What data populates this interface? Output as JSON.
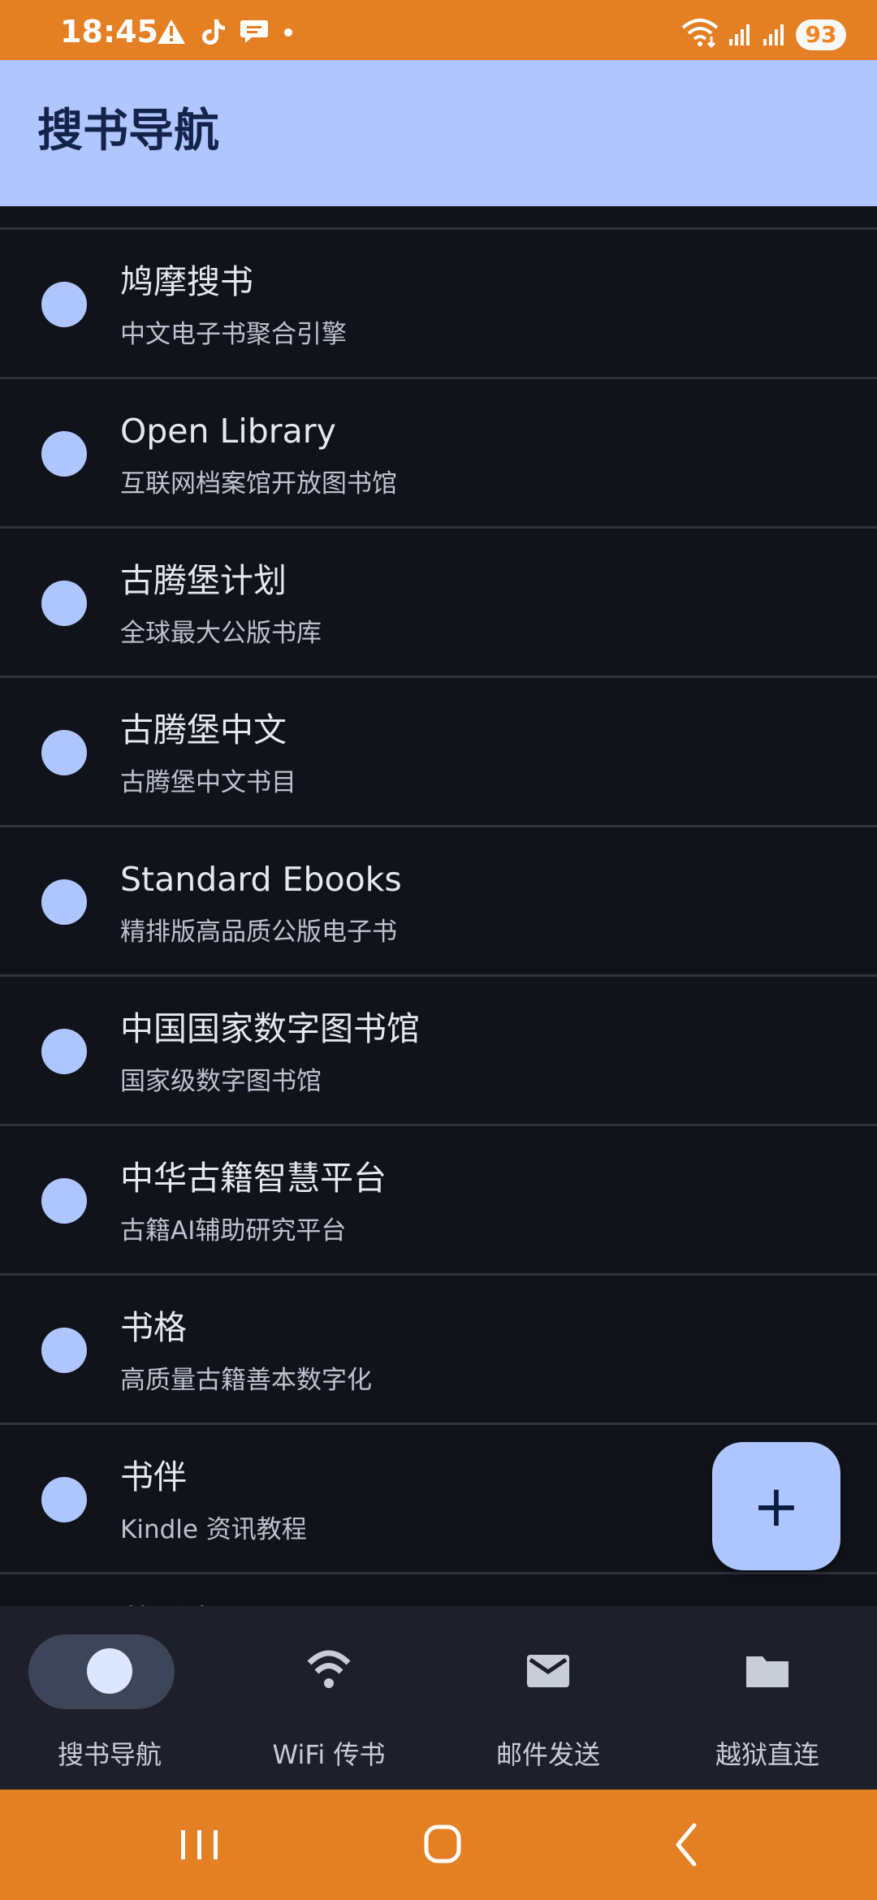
{
  "status_bar": {
    "time": "18:45",
    "battery": "93",
    "left_icons": [
      "warning-icon",
      "tiktok-icon",
      "message-icon",
      "dot-icon"
    ],
    "right_icons": [
      "wifi-status-icon",
      "signal-icon-1",
      "signal-icon-2"
    ],
    "background": "#e57f24"
  },
  "app_bar": {
    "title": "搜书导航",
    "background": "#afc6ff"
  },
  "list": {
    "items": [
      {
        "title": "鸠摩搜书",
        "subtitle": "中文电子书聚合引擎"
      },
      {
        "title": "Open Library",
        "subtitle": "互联网档案馆开放图书馆"
      },
      {
        "title": "古腾堡计划",
        "subtitle": "全球最大公版书库"
      },
      {
        "title": "古腾堡中文",
        "subtitle": "古腾堡中文书目"
      },
      {
        "title": "Standard Ebooks",
        "subtitle": "精排版高品质公版电子书"
      },
      {
        "title": "中国国家数字图书馆",
        "subtitle": "国家级数字图书馆"
      },
      {
        "title": "中华古籍智慧平台",
        "subtitle": "古籍AI辅助研究平台"
      },
      {
        "title": "书格",
        "subtitle": "高质量古籍善本数字化"
      },
      {
        "title": "书伴",
        "subtitle": "Kindle 资讯教程"
      }
    ],
    "partial_title": "苏香书屋",
    "accent": "#aec6ff",
    "background": "#11131a"
  },
  "fab": {
    "label": "+",
    "background": "#aec6ff"
  },
  "bottom_nav": {
    "items": [
      {
        "label": "搜书导航",
        "icon": "circle-icon",
        "active": true
      },
      {
        "label": "WiFi 传书",
        "icon": "wifi-icon",
        "active": false
      },
      {
        "label": "邮件发送",
        "icon": "mail-icon",
        "active": false
      },
      {
        "label": "越狱直连",
        "icon": "folder-icon",
        "active": false
      }
    ],
    "background": "#1d2028"
  },
  "system_nav": {
    "buttons": [
      "recents-icon",
      "home-icon",
      "back-icon"
    ],
    "background": "#e57f24"
  }
}
